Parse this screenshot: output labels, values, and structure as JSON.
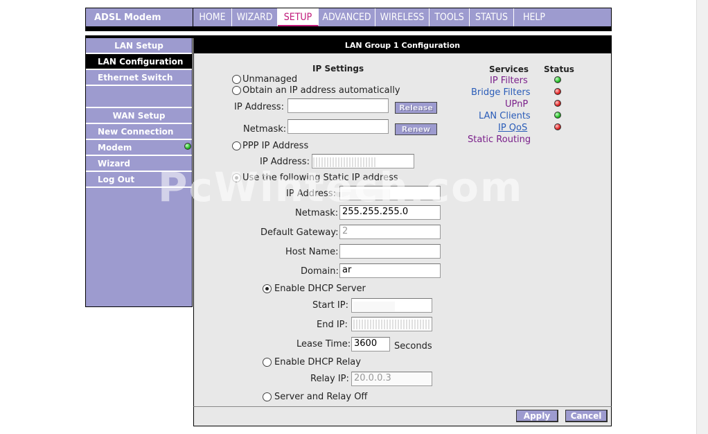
{
  "brand": "ADSL Modem",
  "nav": [
    {
      "label": "HOME",
      "width": 56
    },
    {
      "label": "WIZARD",
      "width": 66
    },
    {
      "label": "SETUP",
      "width": 59,
      "active": true
    },
    {
      "label": "ADVANCED",
      "width": 82
    },
    {
      "label": "WIRELESS",
      "width": 78
    },
    {
      "label": "TOOLS",
      "width": 58
    },
    {
      "label": "STATUS",
      "width": 64
    },
    {
      "label": "HELP",
      "width": 56
    }
  ],
  "sidebar": {
    "lan_header": "LAN Setup",
    "lan_config": "LAN Configuration",
    "ethernet_switch": "Ethernet Switch",
    "wan_header": "WAN Setup",
    "new_connection": "New Connection",
    "modem": "Modem",
    "wizard": "Wizard",
    "logout": "Log Out"
  },
  "panel_title": "LAN Group 1 Configuration",
  "ip_settings": {
    "heading": "IP Settings",
    "unmanaged": "Unmanaged",
    "obtain_auto": "Obtain an IP address automatically",
    "ip_address_label": "IP Address:",
    "netmask_label": "Netmask:",
    "release_button": "Release",
    "renew_button": "Renew",
    "ppp": "PPP IP Address",
    "ppp_ip_label": "IP Address:",
    "static": "Use the following Static IP address",
    "static_ip_label": "IP Address:",
    "static_netmask_label": "Netmask:",
    "static_netmask_value": "255.255.255.0",
    "gateway_label": "Default Gateway:",
    "gateway_value": "2",
    "hostname_label": "Host Name:",
    "hostname_value": "",
    "domain_label": "Domain:",
    "domain_value": "ar",
    "dhcp_server": "Enable DHCP Server",
    "start_ip_label": "Start IP:",
    "end_ip_label": "End IP:",
    "lease_label": "Lease Time:",
    "lease_value": "3600",
    "lease_unit": "Seconds",
    "dhcp_relay": "Enable DHCP Relay",
    "relay_ip_label": "Relay IP:",
    "relay_ip_value": "20.0.0.3",
    "relay_off": "Server and Relay Off"
  },
  "services": {
    "services_heading": "Services",
    "status_heading": "Status",
    "items": [
      {
        "label": "IP Filters",
        "status": "green"
      },
      {
        "label": "Bridge Filters",
        "status": "red"
      },
      {
        "label": "UPnP",
        "status": "red"
      },
      {
        "label": "LAN Clients",
        "status": "green"
      },
      {
        "label": "IP QoS",
        "status": "red"
      },
      {
        "label": "Static Routing",
        "status": null
      }
    ]
  },
  "footer": {
    "apply": "Apply",
    "cancel": "Cancel"
  },
  "watermark": "PcWintech.com"
}
